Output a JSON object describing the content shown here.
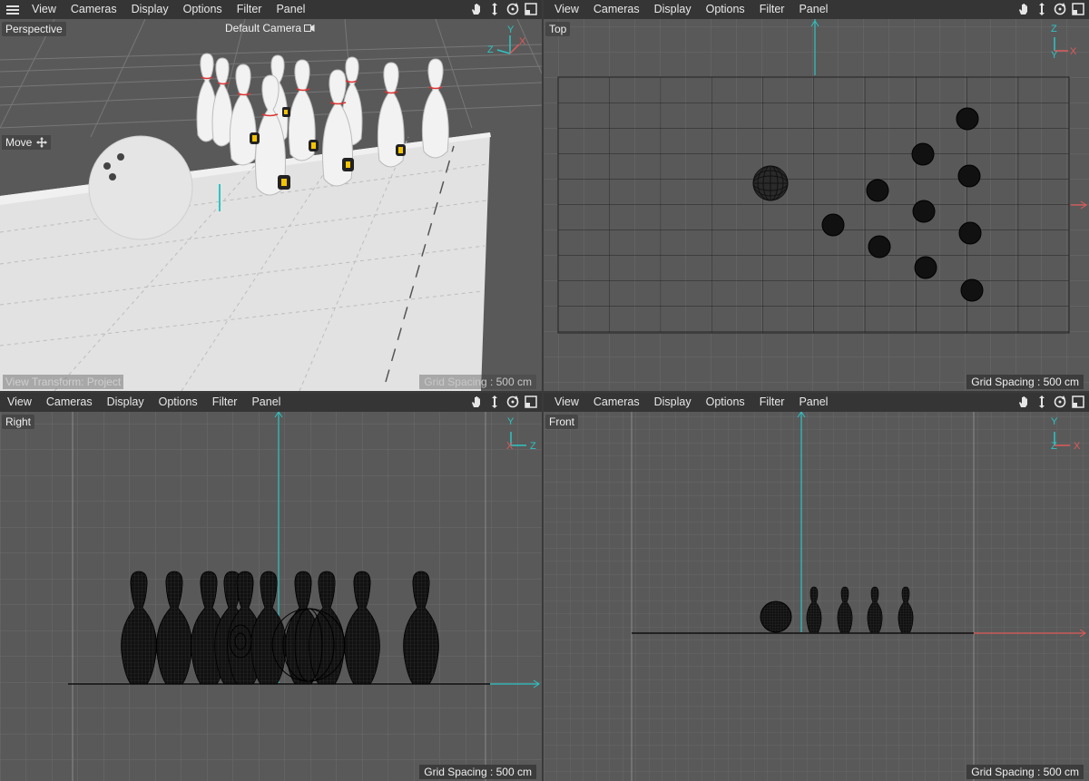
{
  "menu": [
    "View",
    "Cameras",
    "Display",
    "Options",
    "Filter",
    "Panel"
  ],
  "viewports": {
    "perspective": {
      "label": "Perspective",
      "camera": "Default Camera",
      "move_label": "Move",
      "view_transform": "View Transform: Project",
      "grid_spacing": "Grid Spacing : 500 cm"
    },
    "top": {
      "label": "Top",
      "grid_spacing": "Grid Spacing : 500 cm"
    },
    "right": {
      "label": "Right",
      "grid_spacing": "Grid Spacing : 500 cm"
    },
    "front": {
      "label": "Front",
      "grid_spacing": "Grid Spacing : 500 cm"
    }
  },
  "axes": {
    "x": "X",
    "y": "Y",
    "z": "Z"
  },
  "colors": {
    "x_axis": "#e05a5a",
    "y_axis": "#2ec4c4",
    "z_axis": "#2ec4c4",
    "menubar": "#353535",
    "viewport_bg": "#595959",
    "floor": "#e0e0e0"
  },
  "icons": [
    "hamburger-menu-icon",
    "pan-hand-icon",
    "move-arrows-icon",
    "rotate-icon",
    "maximize-icon",
    "camera-icon",
    "move-cross-icon"
  ]
}
